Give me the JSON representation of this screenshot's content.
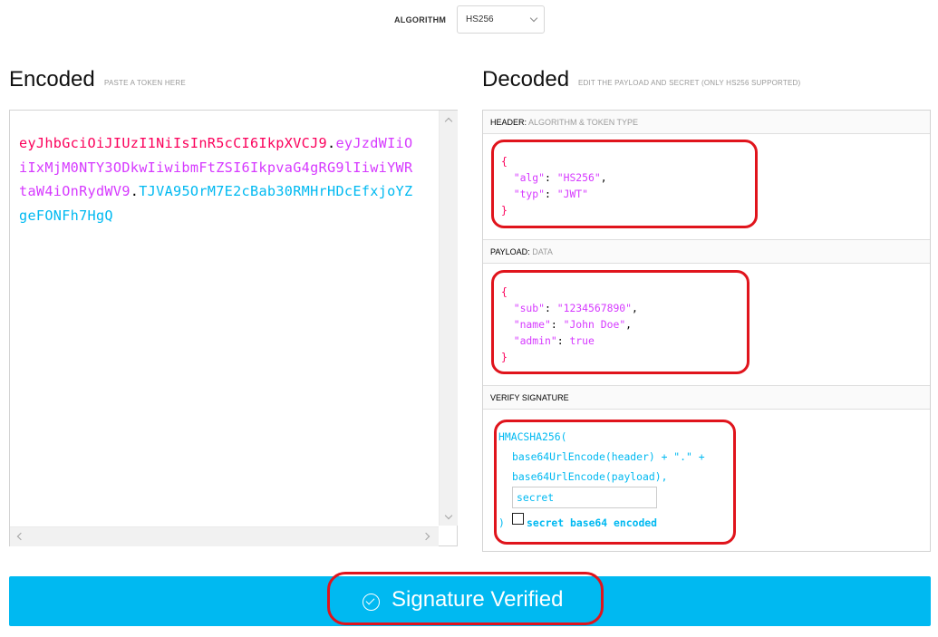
{
  "algorithm": {
    "label": "ALGORITHM",
    "selected": "HS256"
  },
  "encoded": {
    "title": "Encoded",
    "subtitle": "PASTE A TOKEN HERE",
    "header_part_a": "eyJhbGciOiJIUzI1NiIsInR5cCI6IkpXVCJ9",
    "payload_part": "eyJzdWIiOiIxMjM0NTY3ODkwIiwibmFtZSI6IkpvaG4gRG9lIiwiYWRtaW4iOnRydWV9",
    "signature_part": "TJVA95OrM7E2cBab30RMHrHDcEfxjoYZgeFONFh7HgQ",
    "dot": "."
  },
  "decoded": {
    "title": "Decoded",
    "subtitle": "EDIT THE PAYLOAD AND SECRET (ONLY HS256 SUPPORTED)",
    "header_section": {
      "label": "HEADER:",
      "sub": "ALGORITHM & TOKEN TYPE"
    },
    "payload_section": {
      "label": "PAYLOAD:",
      "sub": "DATA"
    },
    "verify_section": {
      "label": "VERIFY SIGNATURE"
    },
    "header_json": {
      "open": "{",
      "close": "}",
      "alg_key": "\"alg\"",
      "alg_val": "\"HS256\"",
      "typ_key": "\"typ\"",
      "typ_val": "\"JWT\""
    },
    "payload_json": {
      "open": "{",
      "close": "}",
      "sub_key": "\"sub\"",
      "sub_val": "\"1234567890\"",
      "name_key": "\"name\"",
      "name_val": "\"John Doe\"",
      "admin_key": "\"admin\"",
      "admin_val": "true"
    },
    "verify": {
      "line1": "HMACSHA256(",
      "line2": "base64UrlEncode(header) + \".\" +",
      "line3": "base64UrlEncode(payload),",
      "secret_placeholder": "secret",
      "close": ")",
      "checkbox_label": "secret base64 encoded"
    }
  },
  "status": {
    "text": "Signature Verified"
  },
  "colors": {
    "header": "#fb015b",
    "payload": "#d63aff",
    "signature": "#00b9f1",
    "annotation": "#e0141c"
  }
}
